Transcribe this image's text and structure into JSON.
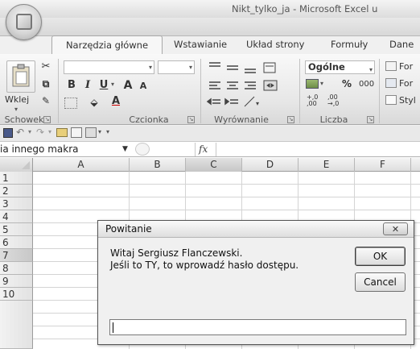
{
  "window": {
    "title": "Nikt_tylko_ja - Microsoft Excel u"
  },
  "tabs": [
    "Narzędzia główne",
    "Wstawianie",
    "Układ strony",
    "Formuły",
    "Dane"
  ],
  "ribbon": {
    "clipboard": {
      "paste_label": "Wklej",
      "group_label": "Schowek"
    },
    "font": {
      "group_label": "Czcionka",
      "bold": "B",
      "italic": "I",
      "underline": "U",
      "grow": "A",
      "shrink": "A",
      "font_color": "A"
    },
    "alignment": {
      "group_label": "Wyrównanie"
    },
    "number": {
      "group_label": "Liczba",
      "format": "Ogólne",
      "percent": "%",
      "thousands": "000",
      "inc_dec": "+,0 ,00",
      "dec_dec": ",00 →,0"
    },
    "styles": {
      "items": [
        "For",
        "For",
        "Styl"
      ]
    }
  },
  "formula_bar": {
    "name_box": "ia innego makra",
    "fx": "fx"
  },
  "sheet": {
    "columns": [
      "A",
      "B",
      "C",
      "D",
      "E",
      "F"
    ],
    "rows": [
      "1",
      "2",
      "3",
      "4",
      "5",
      "6",
      "7",
      "8",
      "9",
      "10"
    ],
    "selected_column": "C",
    "selected_row": "7"
  },
  "dialog": {
    "title": "Powitanie",
    "close": "✕",
    "line1": "Witaj Sergiusz Flanczewski.",
    "line2": "Jeśli to TY, to wprowadź hasło dostępu.",
    "ok_label": "OK",
    "cancel_label": "Cancel",
    "input_value": ""
  }
}
